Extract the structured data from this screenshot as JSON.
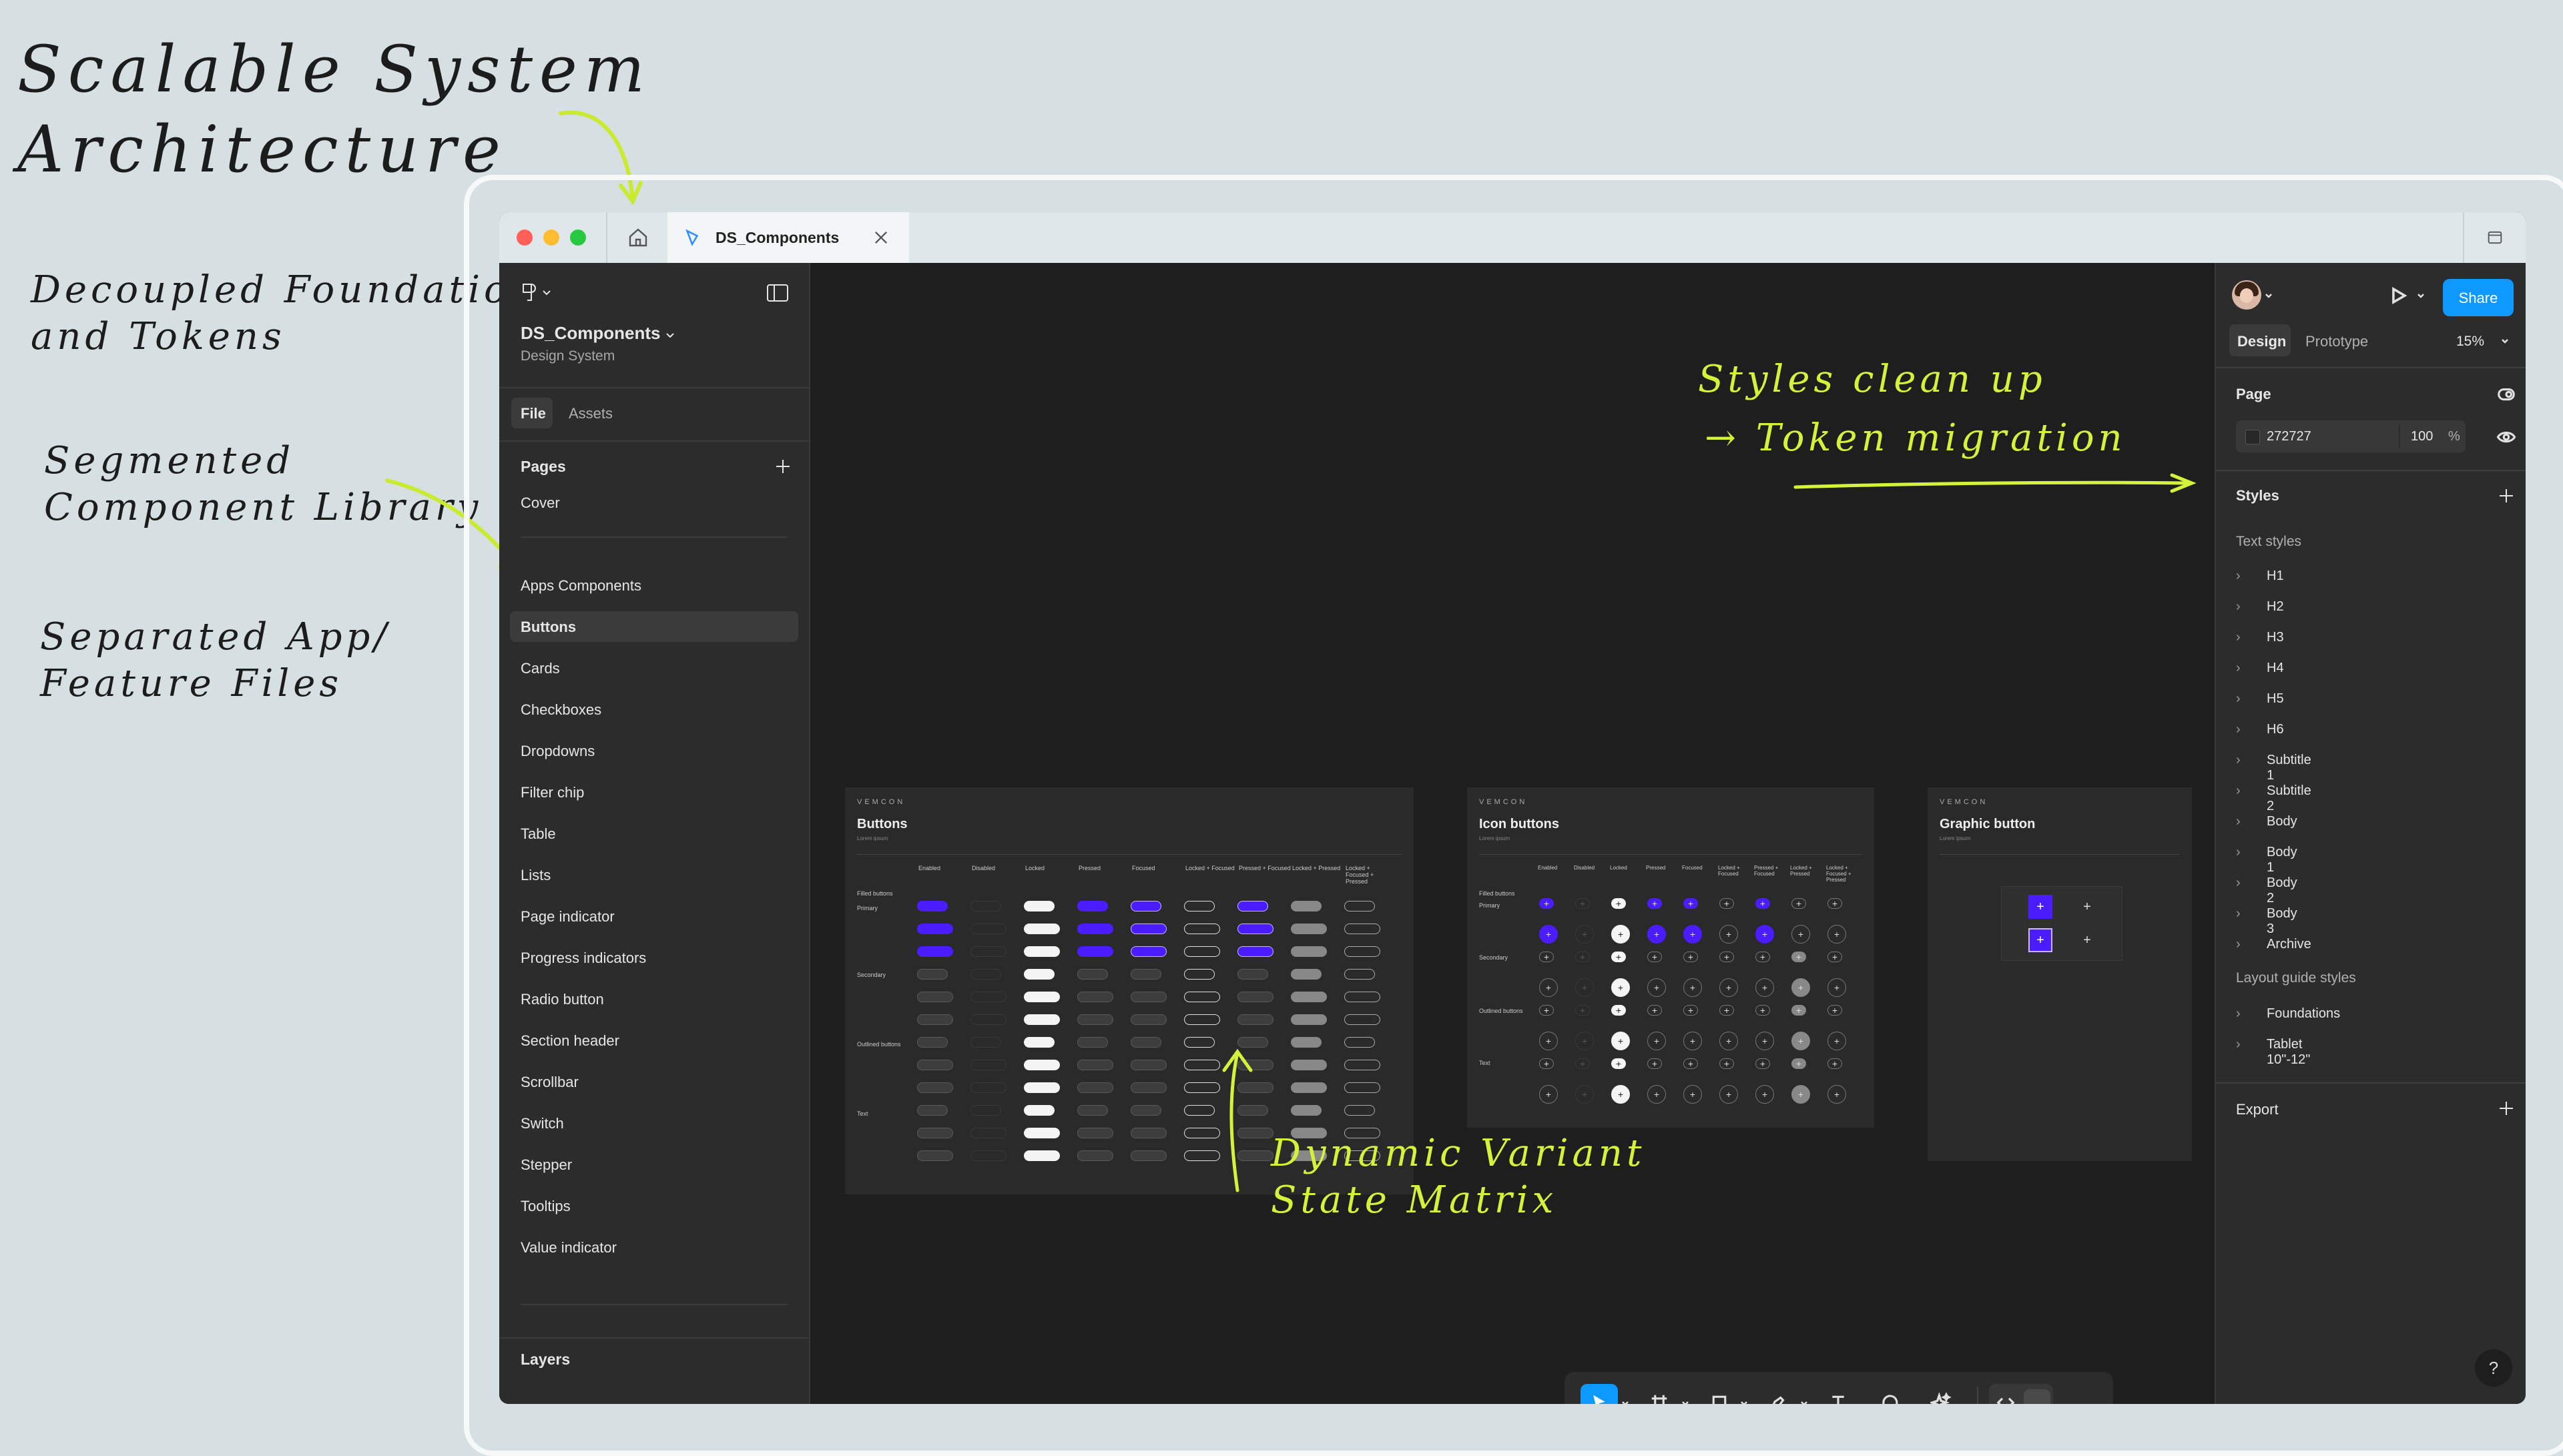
{
  "annotations": {
    "title": "Scalable System\nArchitecture",
    "decoupled": "Decoupled Foundations\nand Tokens",
    "segmented": "Segmented\nComponent Library",
    "separated": "Separated App/\nFeature Files",
    "styles_cleanup": "Styles clean up",
    "token_migration": "→ Token migration",
    "dynamic": "Dynamic Variant\nState Matrix"
  },
  "tab": {
    "file_name": "DS_Components"
  },
  "left_panel": {
    "file_title": "DS_Components",
    "file_subtitle": "Design System",
    "tabs": [
      "File",
      "Assets"
    ],
    "pages_heading": "Pages",
    "pages": [
      "Cover",
      "Apps Components",
      "Buttons",
      "Cards",
      "Checkboxes",
      "Dropdowns",
      "Filter chip",
      "Table",
      "Lists",
      "Page indicator",
      "Progress indicators",
      "Radio button",
      "Section header",
      "Scrollbar",
      "Switch",
      "Stepper",
      "Tooltips",
      "Value indicator"
    ],
    "selected_page": "Buttons",
    "layers_heading": "Layers"
  },
  "right_panel": {
    "share_label": "Share",
    "tabs": [
      "Design",
      "Prototype"
    ],
    "zoom": "15%",
    "page_heading": "Page",
    "page_color": "272727",
    "page_opacity": "100",
    "page_opacity_unit": "%",
    "styles_heading": "Styles",
    "text_styles_heading": "Text styles",
    "text_styles": [
      "H1",
      "H2",
      "H3",
      "H4",
      "H5",
      "H6",
      "Subtitle 1",
      "Subtitle 2",
      "Body",
      "Body 1",
      "Body 2",
      "Body 3",
      "Archive"
    ],
    "layout_heading": "Layout guide styles",
    "layout_styles": [
      "Foundations",
      "Tablet 10\"-12\""
    ],
    "export_heading": "Export"
  },
  "canvas": {
    "frames": [
      {
        "brand": "VEMCON",
        "title": "Buttons",
        "subtitle": "Lorem ipsum"
      },
      {
        "brand": "VEMCON",
        "title": "Icon buttons",
        "subtitle": "Lorem ipsum"
      },
      {
        "brand": "VEMCON",
        "title": "Graphic button",
        "subtitle": "Lorem ipsum"
      }
    ],
    "states": [
      "Enabled",
      "Disabled",
      "Locked",
      "Pressed",
      "Focused",
      "Locked + Focused",
      "Pressed + Focused",
      "Locked + Pressed",
      "Locked + Focused + Pressed"
    ],
    "groups_buttons": [
      "Filled buttons",
      "Primary",
      "Secondary",
      "Outlined buttons",
      "Text"
    ],
    "groups_icons": [
      "Filled buttons",
      "Primary",
      "Secondary",
      "Outlined buttons",
      "Text"
    ]
  },
  "colors": {
    "accent": "#0d99ff",
    "purple": "#4b1cff",
    "highlighter": "#d4f23a",
    "canvas": "#1e1e1e",
    "panel": "#2c2c2c"
  }
}
